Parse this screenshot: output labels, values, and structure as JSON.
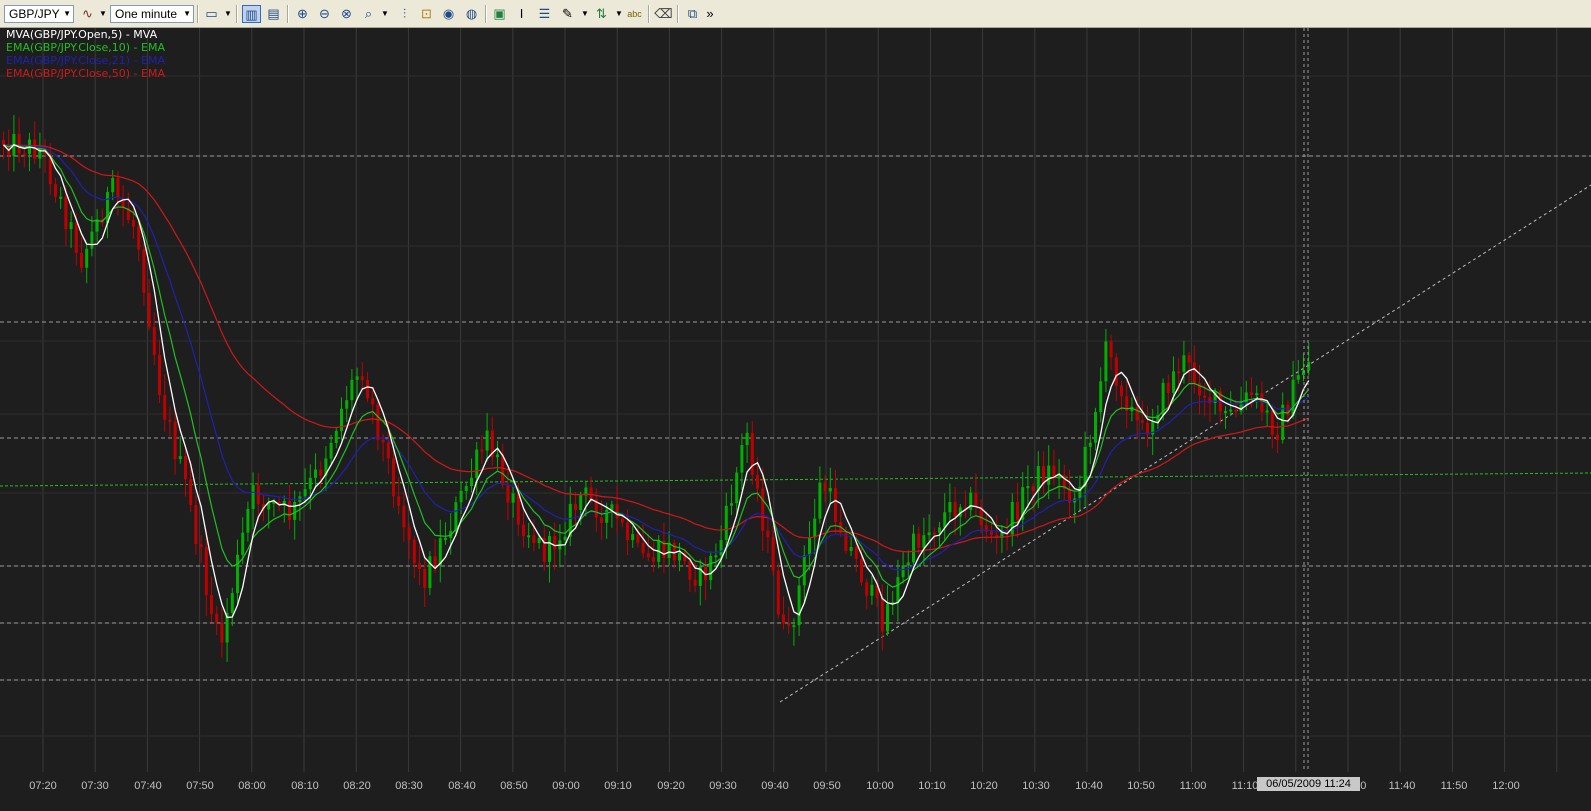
{
  "toolbar": {
    "symbol": "GBP/JPY",
    "timeframe": "One minute",
    "overflow": "»",
    "icons": [
      "indicator-icon",
      "chart-type-icon",
      "candle-icon",
      "bar-icon",
      "zoom-in-icon",
      "zoom-out-icon",
      "zoom-fit-icon",
      "zoom-range-icon",
      "fib-icon",
      "lock-icon",
      "eye-icon",
      "globe-icon",
      "image-icon",
      "text-cursor-icon",
      "grid-icon",
      "pen-icon",
      "arrows-icon",
      "abc-icon",
      "eraser-icon",
      "window-icon"
    ]
  },
  "legend": [
    {
      "text": "MVA(GBP/JPY.Open,5) - MVA",
      "color": "#ffffff"
    },
    {
      "text": "EMA(GBP/JPY.Close,10) - EMA",
      "color": "#20c020"
    },
    {
      "text": "EMA(GBP/JPY.Close,21) - EMA",
      "color": "#2020b0"
    },
    {
      "text": "EMA(GBP/JPY.Close,50) - EMA",
      "color": "#d01818"
    }
  ],
  "chart_data": {
    "type": "candlestick",
    "symbol": "GBP/JPY",
    "interval": "One minute",
    "x_tick_labels": [
      "07:20",
      "07:30",
      "07:40",
      "07:50",
      "08:00",
      "08:10",
      "08:20",
      "08:30",
      "08:40",
      "08:50",
      "09:00",
      "09:10",
      "09:20",
      "09:30",
      "09:40",
      "09:50",
      "10:00",
      "10:10",
      "10:20",
      "10:30",
      "10:40",
      "10:50",
      "11:00",
      "11:10",
      "11:30",
      "11:40",
      "11:50",
      "12:00"
    ],
    "crosshair_label": "06/05/2009 11:24",
    "series": [
      {
        "name": "MVA(GBP/JPY.Open,5) - MVA",
        "color": "#ffffff"
      },
      {
        "name": "EMA(GBP/JPY.Close,10) - EMA",
        "color": "#20c020"
      },
      {
        "name": "EMA(GBP/JPY.Close,21) - EMA",
        "color": "#2020b0"
      },
      {
        "name": "EMA(GBP/JPY.Close,50) - EMA",
        "color": "#d01818"
      }
    ],
    "grid": true,
    "up_color": "#00b000",
    "down_color": "#c00000"
  },
  "colors": {
    "background": "#1e1e1e",
    "grid": "#3a3a3a",
    "toolbar": "#ece9d8",
    "up": "#00b000",
    "down": "#c00000"
  }
}
